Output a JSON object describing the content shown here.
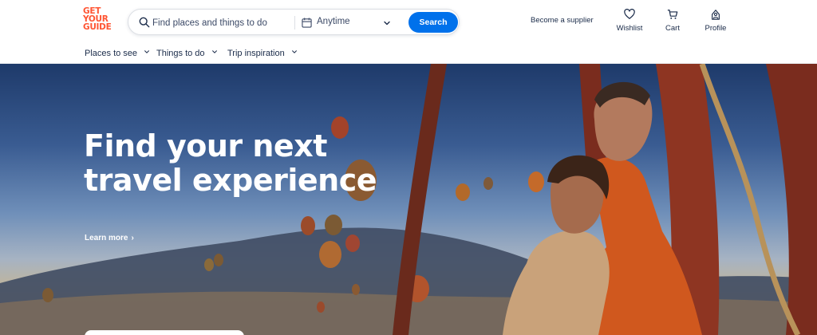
{
  "brand": {
    "logo_lines": [
      "GET",
      "YOUR",
      "GUIDE"
    ],
    "color": "#ff5533"
  },
  "search": {
    "placeholder": "Find places and things to do",
    "date_label": "Anytime",
    "button_label": "Search",
    "button_color": "#0071eb"
  },
  "header": {
    "supplier_link": "Become a supplier",
    "actions": [
      {
        "label": "Wishlist",
        "icon": "heart-icon"
      },
      {
        "label": "Cart",
        "icon": "cart-icon"
      },
      {
        "label": "Profile",
        "icon": "profile-icon"
      }
    ]
  },
  "subnav": {
    "items": [
      "Places to see",
      "Things to do",
      "Trip inspiration"
    ]
  },
  "hero": {
    "title": "Find your next travel experience",
    "link_label": "Learn more"
  }
}
